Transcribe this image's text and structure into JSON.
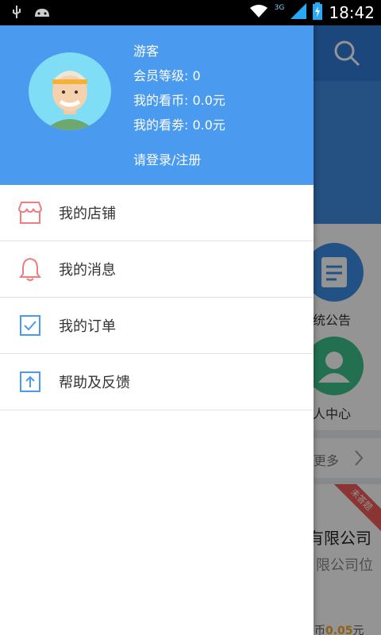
{
  "status_bar": {
    "time": "18:42",
    "network": "3G",
    "icons": [
      "usb-icon",
      "android-icon",
      "wifi-icon",
      "signal-icon",
      "battery-icon"
    ]
  },
  "drawer": {
    "user": {
      "name": "游客",
      "member_level": "会员等级: 0",
      "coins": "我的看币: 0.0元",
      "vouchers": "我的看劵: 0.0元",
      "login_link": "请登录/注册"
    },
    "menu": [
      {
        "label": "我的店铺",
        "icon": "shop-icon",
        "color": "#ef7d7d"
      },
      {
        "label": "我的消息",
        "icon": "bell-icon",
        "color": "#ef7d7d"
      },
      {
        "label": "我的订单",
        "icon": "checkbox-icon",
        "color": "#4a9bf0"
      },
      {
        "label": "帮助及反馈",
        "icon": "upload-icon",
        "color": "#4a9bf0"
      }
    ]
  },
  "background": {
    "tiles": [
      {
        "label": "系统公告",
        "icon": "document-icon",
        "color": "#3b8ee6"
      },
      {
        "label": "个人中心",
        "icon": "person-icon",
        "color": "#3cc18a"
      }
    ],
    "more_label": "更多",
    "card": {
      "title": "有限公司",
      "subtitle": "限公司位",
      "price_prefix": "币",
      "price_value": "0.05",
      "price_suffix": "元",
      "ribbon": "未答题"
    }
  },
  "colors": {
    "drawer_header": "#4a9bf0",
    "accent_red": "#ef7d7d",
    "accent_blue": "#4a9bf0"
  }
}
